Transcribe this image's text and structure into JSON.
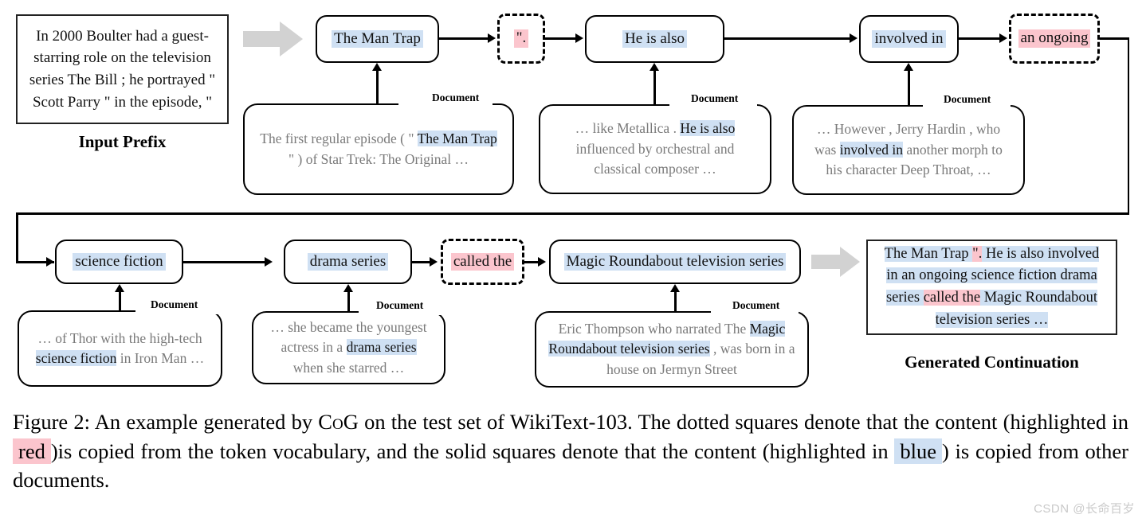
{
  "figure": {
    "input_prefix": {
      "text": "In 2000 Boulter had a guest-starring role on the television series The Bill ; he portrayed \" Scott Parry \" in the episode, \"",
      "label": "Input Prefix"
    },
    "generated_continuation": {
      "label": "Generated Continuation",
      "segments": [
        {
          "text": "The Man Trap ",
          "style": "blue"
        },
        {
          "text": "\".",
          "style": "pink"
        },
        {
          "text": " He is also involved in an ongoing science fiction drama series ",
          "style": "blue"
        },
        {
          "text": "called the",
          "style": "pink"
        },
        {
          "text": " Magic Roundabout television series …",
          "style": "blue"
        }
      ]
    },
    "nodes": [
      {
        "id": "n1",
        "text": "The Man Trap",
        "style": "blue",
        "border": "solid"
      },
      {
        "id": "n2",
        "text": "\".",
        "style": "pink",
        "border": "dashed"
      },
      {
        "id": "n3",
        "text": "He is also",
        "style": "blue",
        "border": "solid"
      },
      {
        "id": "n4",
        "text": "involved in",
        "style": "blue",
        "border": "solid"
      },
      {
        "id": "n5",
        "text": "an ongoing",
        "style": "pink",
        "border": "dashed"
      },
      {
        "id": "n6",
        "text": "science fiction",
        "style": "blue",
        "border": "solid"
      },
      {
        "id": "n7",
        "text": "drama series",
        "style": "blue",
        "border": "solid"
      },
      {
        "id": "n8",
        "text": "called the",
        "style": "pink",
        "border": "dashed"
      },
      {
        "id": "n9",
        "text": "Magic Roundabout television series",
        "style": "blue",
        "border": "solid"
      }
    ],
    "documents": [
      {
        "id": "d1",
        "label": "Document",
        "parts": [
          {
            "text": "The first regular episode ( \" ",
            "style": "plain"
          },
          {
            "text": "The Man Trap",
            "style": "blue"
          },
          {
            "text": " \" ) of Star Trek: The Original …",
            "style": "plain"
          }
        ]
      },
      {
        "id": "d2",
        "label": "Document",
        "parts": [
          {
            "text": "… like Metallica . ",
            "style": "plain"
          },
          {
            "text": "He is also",
            "style": "blue"
          },
          {
            "text": " influenced by orchestral and classical composer …",
            "style": "plain"
          }
        ]
      },
      {
        "id": "d3",
        "label": "Document",
        "parts": [
          {
            "text": "… However , Jerry Hardin , who was ",
            "style": "plain"
          },
          {
            "text": "involved in",
            "style": "blue"
          },
          {
            "text": " another morph to his character Deep Throat, …",
            "style": "plain"
          }
        ]
      },
      {
        "id": "d4",
        "label": "Document",
        "parts": [
          {
            "text": "… of Thor with the high-tech ",
            "style": "plain"
          },
          {
            "text": "science fiction",
            "style": "blue"
          },
          {
            "text": " in Iron Man …",
            "style": "plain"
          }
        ]
      },
      {
        "id": "d5",
        "label": "Document",
        "parts": [
          {
            "text": "… she became the youngest actress in a ",
            "style": "plain"
          },
          {
            "text": "drama series",
            "style": "blue"
          },
          {
            "text": " when she starred …",
            "style": "plain"
          }
        ]
      },
      {
        "id": "d6",
        "label": "Document",
        "parts": [
          {
            "text": "Eric Thompson who narrated The ",
            "style": "plain"
          },
          {
            "text": "Magic Roundabout television series",
            "style": "blue"
          },
          {
            "text": " , was born in a house on Jermyn Street",
            "style": "plain"
          }
        ]
      }
    ],
    "caption": {
      "prefix": "Figure 2: An example generated by ",
      "model": "CoG",
      "mid1": " on the test set of WikiText-103. The dotted squares denote that the content (highlighted in ",
      "red_word": "red",
      "mid2": ")is copied from the token vocabulary, and the solid squares denote that the content (highlighted in ",
      "blue_word": "blue",
      "suffix": ") is copied from other documents."
    },
    "watermark": "CSDN @长命百岁",
    "colors": {
      "blue_highlight": "#cfe0f3",
      "pink_highlight": "#fbc5cd",
      "arrow_gray": "#d2d2d2",
      "doc_text": "#7a7a7a"
    }
  }
}
